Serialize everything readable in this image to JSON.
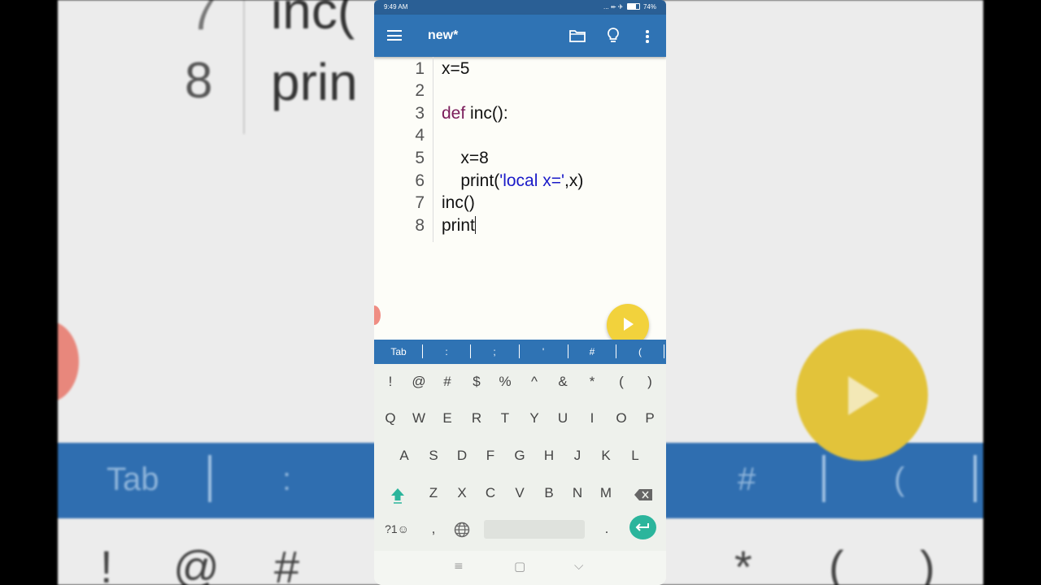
{
  "status_bar": {
    "time": "9:49 AM",
    "battery": "74%",
    "icons_text": "... ⇷ ✈"
  },
  "app_bar": {
    "title": "new*",
    "icons": [
      "menu-icon",
      "folder-icon",
      "lightbulb-icon",
      "more-vert-icon"
    ]
  },
  "editor": {
    "line_numbers": [
      "1",
      "2",
      "3",
      "4",
      "5",
      "6",
      "7",
      "8"
    ],
    "lines": {
      "l1": "x=5",
      "l3_kw": "def",
      "l3_rest": " inc():",
      "l5": "    x=8",
      "l6_pre": "    print(",
      "l6_str": "'local x='",
      "l6_post": ",x)",
      "l7": "inc()",
      "l8": "print"
    }
  },
  "symbol_bar": [
    "Tab",
    ":",
    ";",
    "'",
    "#",
    "("
  ],
  "keyboard": {
    "row_symbols": [
      "!",
      "@",
      "#",
      "$",
      "%",
      "^",
      "&",
      "*",
      "(",
      ")"
    ],
    "row1": [
      "Q",
      "W",
      "E",
      "R",
      "T",
      "Y",
      "U",
      "I",
      "O",
      "P"
    ],
    "row2": [
      "A",
      "S",
      "D",
      "F",
      "G",
      "H",
      "J",
      "K",
      "L"
    ],
    "row3": [
      "Z",
      "X",
      "C",
      "V",
      "B",
      "N",
      "M"
    ],
    "bottom": {
      "symbols_key": "?1☺",
      "comma": ",",
      "period": "."
    }
  },
  "nav_bar": {
    "recent": "≡",
    "home": "▢",
    "back": "⌵"
  },
  "backdrop": {
    "line_7": "7",
    "line_8": "8",
    "code_7": "inc(",
    "code_8": "prin",
    "bar_tab": "Tab",
    "bar_colon": ":",
    "bar_hash": "#",
    "bar_paren": "(",
    "keys": [
      "!",
      "@",
      "#",
      "*",
      "(",
      ")"
    ]
  },
  "colors": {
    "app_bar": "#2f73b4",
    "status_bar": "#2a5f95",
    "keyword": "#7a1b5a",
    "string": "#1a1ac8",
    "fab": "#f2d23c",
    "enter_key": "#2bb59c"
  }
}
